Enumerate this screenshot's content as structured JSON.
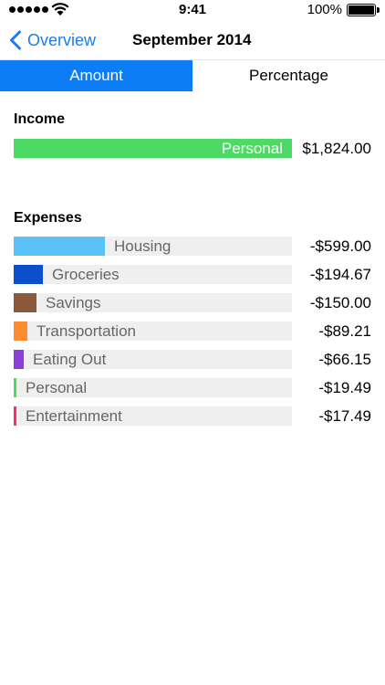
{
  "status_bar": {
    "time": "9:41",
    "battery": "100%",
    "signal_icon": "signal-dots-icon",
    "wifi_icon": "wifi-icon"
  },
  "nav": {
    "back_label": "Overview",
    "back_icon": "chevron-left-icon",
    "title": "September 2014"
  },
  "segments": [
    {
      "label": "Amount",
      "selected": true
    },
    {
      "label": "Percentage",
      "selected": false
    }
  ],
  "income": {
    "title": "Income",
    "items": [
      {
        "label": "Personal",
        "amount": "$1,824.00",
        "value": 1824.0,
        "color": "#4cd964"
      }
    ]
  },
  "expenses": {
    "title": "Expenses",
    "items": [
      {
        "label": "Housing",
        "amount": "-$599.00",
        "value": 599.0,
        "color": "#5ac0f8"
      },
      {
        "label": "Groceries",
        "amount": "-$194.67",
        "value": 194.67,
        "color": "#0b4fcc"
      },
      {
        "label": "Savings",
        "amount": "-$150.00",
        "value": 150.0,
        "color": "#8b5a3c"
      },
      {
        "label": "Transportation",
        "amount": "-$89.21",
        "value": 89.21,
        "color": "#ff8c2e"
      },
      {
        "label": "Eating Out",
        "amount": "-$66.15",
        "value": 66.15,
        "color": "#8a3fd9"
      },
      {
        "label": "Personal",
        "amount": "-$19.49",
        "value": 19.49,
        "color": "#4cd964"
      },
      {
        "label": "Entertainment",
        "amount": "-$17.49",
        "value": 17.49,
        "color": "#ff2d6e"
      }
    ]
  }
}
